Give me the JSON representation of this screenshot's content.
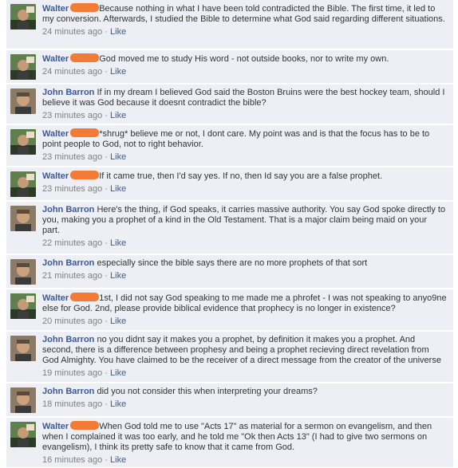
{
  "comments": [
    {
      "author": "Walter",
      "redacted": true,
      "avatar": "walter",
      "text": "Because nothing in what I have been told contradicted the Bible. The first time, it led to my conversion. Afterwards, I studied the Bible to determine what God said regarding different situations.",
      "time": "24 minutes ago",
      "like": "Like"
    },
    {
      "author": "Walter",
      "redacted": true,
      "avatar": "walter",
      "text": "God moved me to study His word - not outside books, nor to write my own.",
      "time": "24 minutes ago",
      "like": "Like"
    },
    {
      "author": "John Barron",
      "redacted": false,
      "avatar": "john",
      "text": "If in my dream I believed God said the Boston Bruins were the best hockey team, should I believe it was God because it doesnt contradict the bible?",
      "time": "23 minutes ago",
      "like": "Like"
    },
    {
      "author": "Walter",
      "redacted": true,
      "avatar": "walter",
      "text": "*shrug* believe me or not, I dont care. My point was and is that the focus has to be to point people to God, not to right behavior.",
      "time": "23 minutes ago",
      "like": "Like"
    },
    {
      "author": "Walter",
      "redacted": true,
      "avatar": "walter",
      "text": "If it came true, then I'd say yes. If no, then Id say you are a false prophet.",
      "time": "23 minutes ago",
      "like": "Like"
    },
    {
      "author": "John Barron",
      "redacted": false,
      "avatar": "john",
      "text": "Here's the thing, if God speaks, it carries massive authority. You say God spoke directly to you, making you a prophet of a kind in the Old Testament. That is a major claim being maid on your part.",
      "time": "22 minutes ago",
      "like": "Like"
    },
    {
      "author": "John Barron",
      "redacted": false,
      "avatar": "john",
      "text": "especially since the bible says there are no more prophets of that sort",
      "time": "21 minutes ago",
      "like": "Like"
    },
    {
      "author": "Walter",
      "redacted": true,
      "avatar": "walter",
      "text": "1st, I did not say God speaking to me made me a phrofet - I was not speaking to anyo9ne else for God. 2nd, please provide biblical evidence that prophecy is no longer in existence?",
      "time": "20 minutes ago",
      "like": "Like"
    },
    {
      "author": "John Barron",
      "redacted": false,
      "avatar": "john",
      "text": "no you didnt say it makes you a prophet, by definition it makes you a prophet. And second, there is a difference between prophesy and being a prophet recieving direct revelation from God Almighty. You have claimed to be the receiver of a direct message from the creator of the universe",
      "time": "19 minutes ago",
      "like": "Like"
    },
    {
      "author": "John Barron",
      "redacted": false,
      "avatar": "john",
      "text": "did you not consider this when interpreting your dreams?",
      "time": "18 minutes ago",
      "like": "Like"
    },
    {
      "author": "Walter",
      "redacted": true,
      "avatar": "walter",
      "text": "When God told me to use \"Acts 17\" as material for a sermon on evangelism, and then when I complained it was too early, and he told me \"Ok then Acts 13\" (I had to give two sermons on evangelism), I think its pretty safe to know that it came from God.",
      "time": "16 minutes ago",
      "like": "Like"
    }
  ],
  "colors": {
    "background": "#edeff4",
    "author_link": "#3b5998",
    "redaction": "#f27b36"
  }
}
